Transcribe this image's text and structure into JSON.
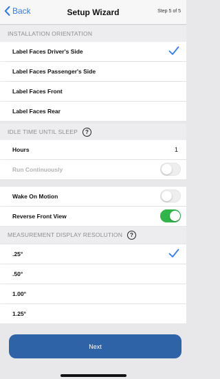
{
  "nav": {
    "back_label": "Back",
    "title": "Setup Wizard",
    "step": "Step 5 of 5"
  },
  "orientation": {
    "header": "INSTALLATION ORIENTATION",
    "options": [
      {
        "label": "Label Faces Driver's Side",
        "selected": true
      },
      {
        "label": "Label Faces Passenger's Side",
        "selected": false
      },
      {
        "label": "Label Faces Front",
        "selected": false
      },
      {
        "label": "Label Faces Rear",
        "selected": false
      }
    ]
  },
  "idle": {
    "header": "IDLE TIME UNTIL SLEEP",
    "help": "?",
    "hours_label": "Hours",
    "hours_value": "1",
    "run_continuously_label": "Run Continuously",
    "run_continuously_on": false
  },
  "motion": {
    "wake_on_motion_label": "Wake On Motion",
    "wake_on_motion_on": false,
    "reverse_front_view_label": "Reverse Front View",
    "reverse_front_view_on": true
  },
  "resolution": {
    "header": "MEASUREMENT DISPLAY RESOLUTION",
    "help": "?",
    "options": [
      {
        "label": ".25°",
        "selected": true
      },
      {
        "label": ".50°",
        "selected": false
      },
      {
        "label": "1.00°",
        "selected": false
      },
      {
        "label": "1.25°",
        "selected": false
      }
    ]
  },
  "next_label": "Next",
  "colors": {
    "accent": "#2f7bf6",
    "button": "#2f63a8",
    "toggle_on": "#31b54a"
  }
}
